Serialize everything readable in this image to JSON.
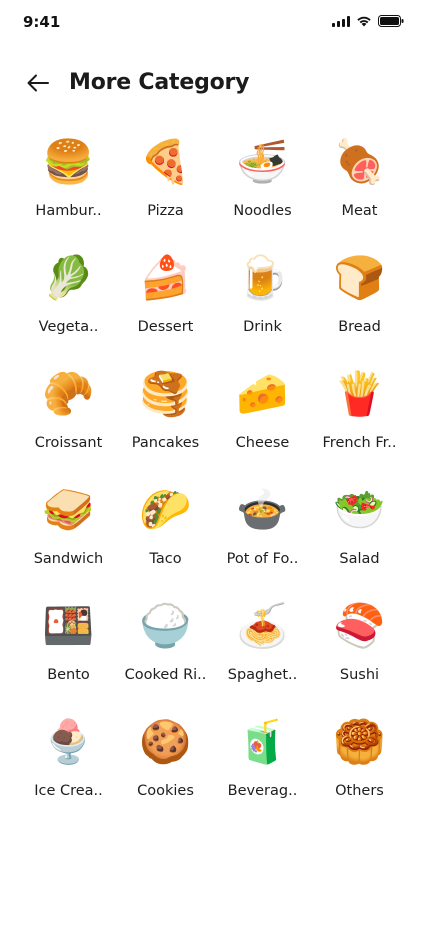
{
  "status_bar": {
    "time": "9:41",
    "icons": [
      "signal-icon",
      "wifi-icon",
      "battery-icon"
    ]
  },
  "header": {
    "back_icon": "arrow-left-icon",
    "title": "More Category"
  },
  "categories": [
    {
      "emoji": "🍔",
      "label": "Hambur.."
    },
    {
      "emoji": "🍕",
      "label": "Pizza"
    },
    {
      "emoji": "🍜",
      "label": "Noodles"
    },
    {
      "emoji": "🍖",
      "label": "Meat"
    },
    {
      "emoji": "🥬",
      "label": "Vegeta.."
    },
    {
      "emoji": "🍰",
      "label": "Dessert"
    },
    {
      "emoji": "🍺",
      "label": "Drink"
    },
    {
      "emoji": "🍞",
      "label": "Bread"
    },
    {
      "emoji": "🥐",
      "label": "Croissant"
    },
    {
      "emoji": "🥞",
      "label": "Pancakes"
    },
    {
      "emoji": "🧀",
      "label": "Cheese"
    },
    {
      "emoji": "🍟",
      "label": "French Fr.."
    },
    {
      "emoji": "🥪",
      "label": "Sandwich"
    },
    {
      "emoji": "🌮",
      "label": "Taco"
    },
    {
      "emoji": "🍲",
      "label": "Pot of Fo.."
    },
    {
      "emoji": "🥗",
      "label": "Salad"
    },
    {
      "emoji": "🍱",
      "label": "Bento"
    },
    {
      "emoji": "🍚",
      "label": "Cooked Ri.."
    },
    {
      "emoji": "🍝",
      "label": "Spaghet.."
    },
    {
      "emoji": "🍣",
      "label": "Sushi"
    },
    {
      "emoji": "🍨",
      "label": "Ice Crea.."
    },
    {
      "emoji": "🍪",
      "label": "Cookies"
    },
    {
      "emoji": "🧃",
      "label": "Beverag.."
    },
    {
      "emoji": "🥮",
      "label": "Others"
    }
  ]
}
